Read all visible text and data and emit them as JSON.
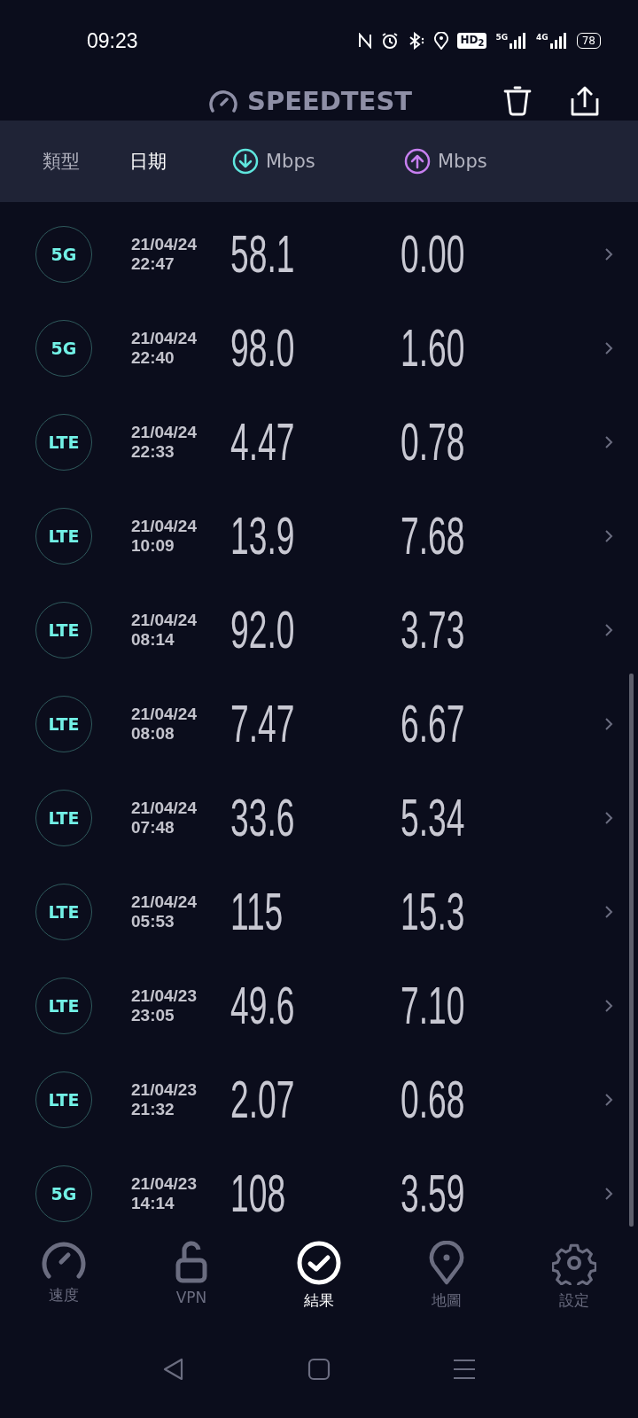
{
  "status_bar": {
    "time": "09:23",
    "hd_badge": "HD$_{2}$",
    "networks": [
      "5G",
      "4G"
    ],
    "battery": "78"
  },
  "header": {
    "title": "SPEEDTEST"
  },
  "columns": [
    {
      "kind": "text",
      "label": "類型",
      "selected": false
    },
    {
      "kind": "text",
      "label": "日期",
      "selected": true
    },
    {
      "kind": "download",
      "label": "Mbps",
      "selected": false
    },
    {
      "kind": "upload",
      "label": "Mbps",
      "selected": false
    }
  ],
  "results": [
    {
      "type": "5G",
      "date": "21/04/24",
      "time": "22:47",
      "download": "58.1",
      "upload": "0.00"
    },
    {
      "type": "5G",
      "date": "21/04/24",
      "time": "22:40",
      "download": "98.0",
      "upload": "1.60"
    },
    {
      "type": "LTE",
      "date": "21/04/24",
      "time": "22:33",
      "download": "4.47",
      "upload": "0.78"
    },
    {
      "type": "LTE",
      "date": "21/04/24",
      "time": "10:09",
      "download": "13.9",
      "upload": "7.68"
    },
    {
      "type": "LTE",
      "date": "21/04/24",
      "time": "08:14",
      "download": "92.0",
      "upload": "3.73"
    },
    {
      "type": "LTE",
      "date": "21/04/24",
      "time": "08:08",
      "download": "7.47",
      "upload": "6.67"
    },
    {
      "type": "LTE",
      "date": "21/04/24",
      "time": "07:48",
      "download": "33.6",
      "upload": "5.34"
    },
    {
      "type": "LTE",
      "date": "21/04/24",
      "time": "05:53",
      "download": "115",
      "upload": "15.3"
    },
    {
      "type": "LTE",
      "date": "21/04/23",
      "time": "23:05",
      "download": "49.6",
      "upload": "7.10"
    },
    {
      "type": "LTE",
      "date": "21/04/23",
      "time": "21:32",
      "download": "2.07",
      "upload": "0.68"
    },
    {
      "type": "5G",
      "date": "21/04/23",
      "time": "14:14",
      "download": "108",
      "upload": "3.59"
    }
  ],
  "bottom_nav": [
    {
      "kind": "gauge",
      "label": "速度",
      "selected": false
    },
    {
      "kind": "lock",
      "label": "VPN",
      "selected": false
    },
    {
      "kind": "check",
      "label": "結果",
      "selected": true
    },
    {
      "kind": "pin",
      "label": "地圖",
      "selected": false
    },
    {
      "kind": "gear",
      "label": "設定",
      "selected": false
    }
  ]
}
